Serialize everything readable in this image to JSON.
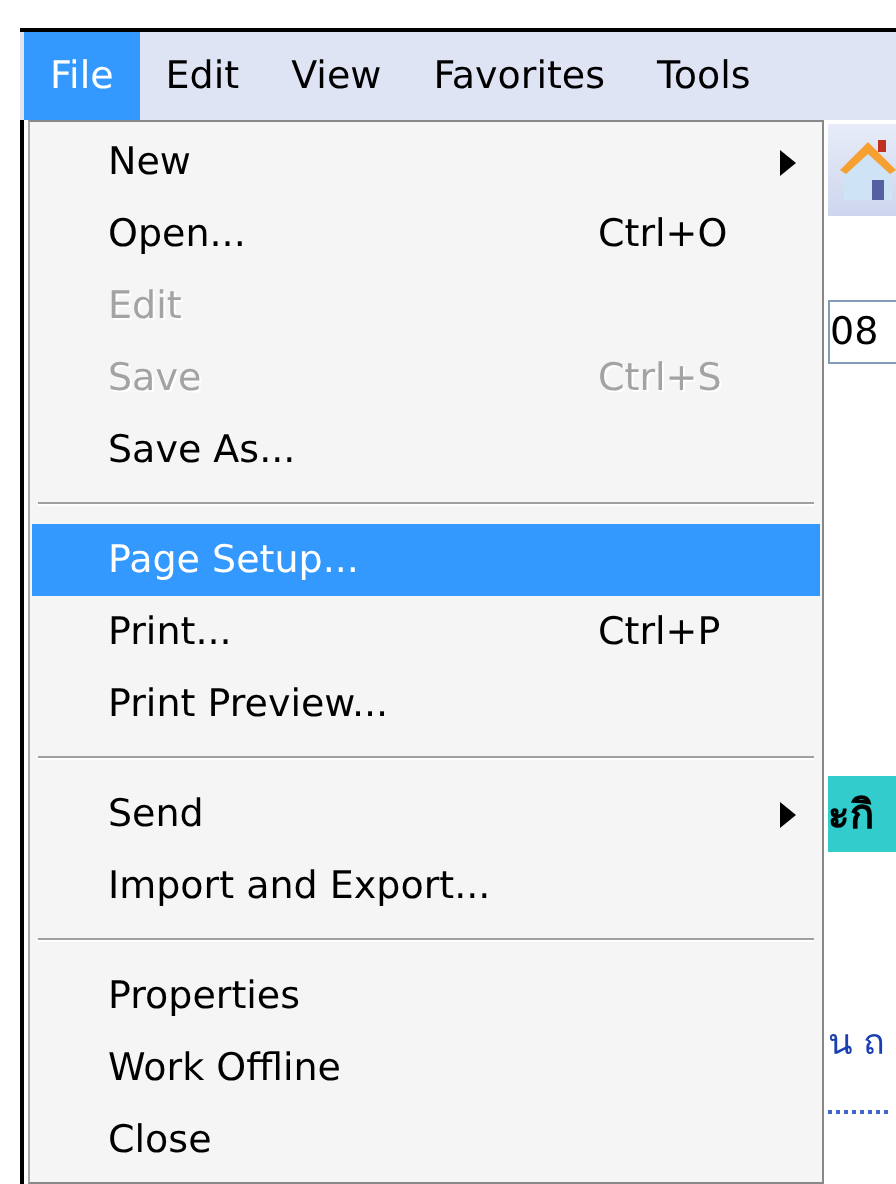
{
  "menubar": [
    {
      "label": "File",
      "selected": true
    },
    {
      "label": "Edit",
      "selected": false
    },
    {
      "label": "View",
      "selected": false
    },
    {
      "label": "Favorites",
      "selected": false
    },
    {
      "label": "Tools",
      "selected": false
    }
  ],
  "file_menu": [
    [
      {
        "label": "New",
        "submenu": true,
        "disabled": false,
        "selected": false
      },
      {
        "label": "Open...",
        "shortcut": "Ctrl+O",
        "submenu": false,
        "disabled": false,
        "selected": false
      },
      {
        "label": "Edit",
        "submenu": false,
        "disabled": true,
        "selected": false
      },
      {
        "label": "Save",
        "shortcut": "Ctrl+S",
        "submenu": false,
        "disabled": true,
        "selected": false
      },
      {
        "label": "Save As...",
        "submenu": false,
        "disabled": false,
        "selected": false
      }
    ],
    [
      {
        "label": "Page Setup...",
        "submenu": false,
        "disabled": false,
        "selected": true
      },
      {
        "label": "Print...",
        "shortcut": "Ctrl+P",
        "submenu": false,
        "disabled": false,
        "selected": false
      },
      {
        "label": "Print Preview...",
        "submenu": false,
        "disabled": false,
        "selected": false
      }
    ],
    [
      {
        "label": "Send",
        "submenu": true,
        "disabled": false,
        "selected": false
      },
      {
        "label": "Import and Export...",
        "submenu": false,
        "disabled": false,
        "selected": false
      }
    ],
    [
      {
        "label": "Properties",
        "submenu": false,
        "disabled": false,
        "selected": false
      },
      {
        "label": "Work Offline",
        "submenu": false,
        "disabled": false,
        "selected": false
      },
      {
        "label": "Close",
        "submenu": false,
        "disabled": false,
        "selected": false
      }
    ]
  ],
  "page": {
    "address_value": "08",
    "banner_text": "ะกิ",
    "link_text": "น ถ"
  }
}
